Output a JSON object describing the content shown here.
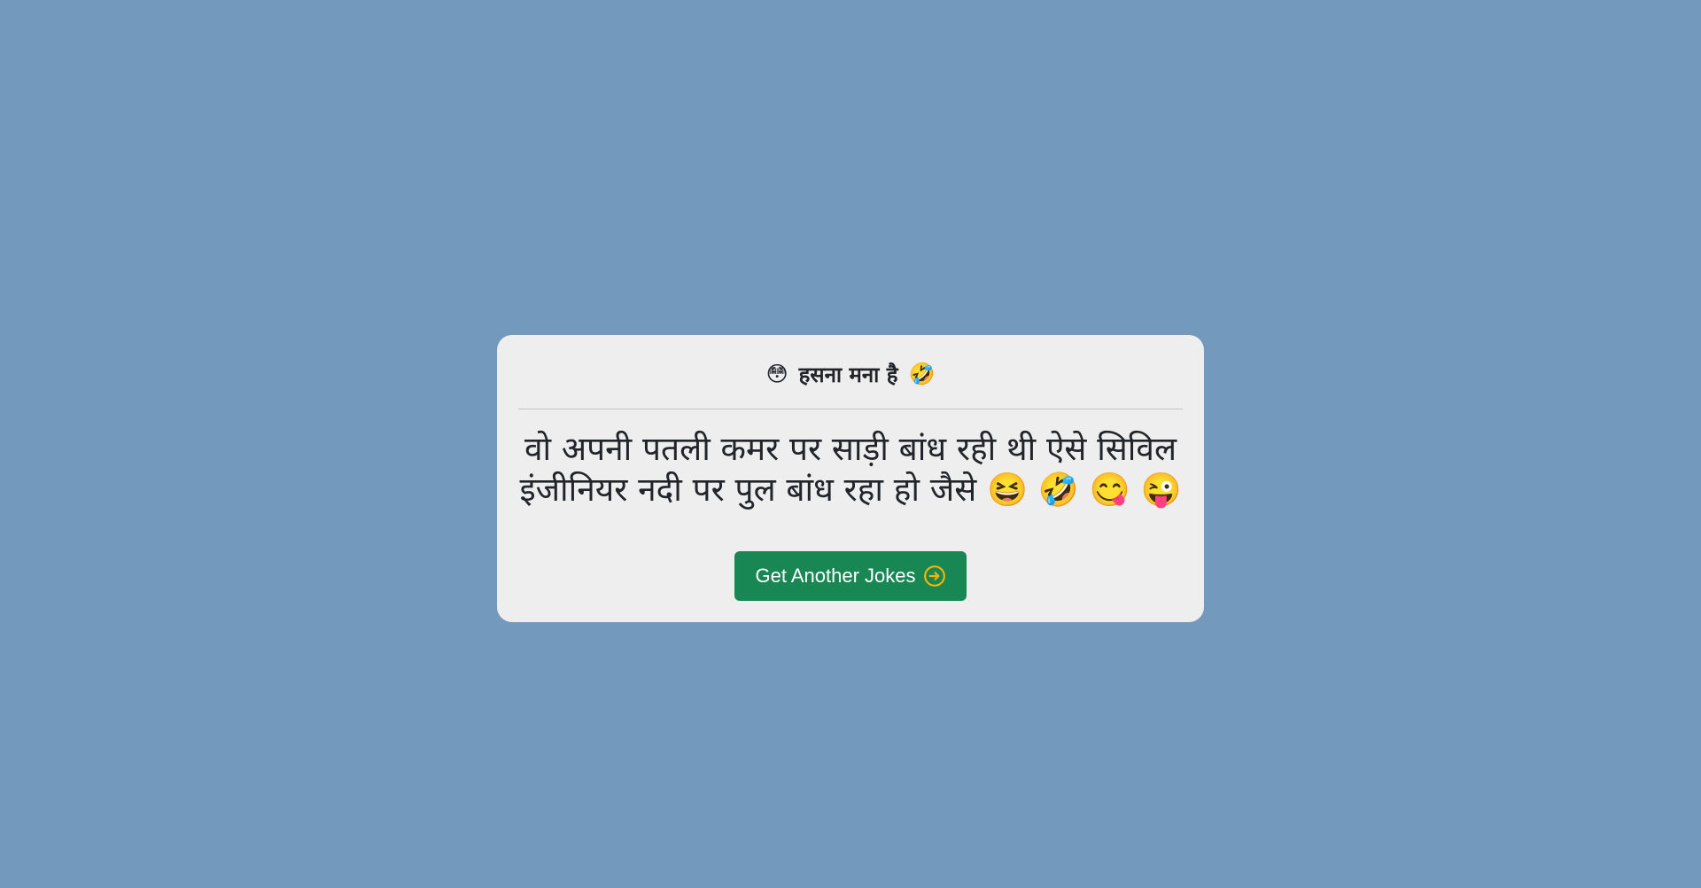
{
  "card": {
    "title": "हसना मना है",
    "title_emoji_left": "😳",
    "title_emoji_right": "🤣"
  },
  "joke": {
    "text": "वो अपनी पतली कमर पर साड़ी बांध रही थी ऐसे सिविल इंजीनियर नदी पर पुल बांध रहा हो जैसे 😆 🤣 😋 😜"
  },
  "button": {
    "label": "Get Another Jokes",
    "icon": "arrow-right-circle-icon",
    "icon_color": "#f5b400",
    "color": "#198754"
  },
  "colors": {
    "background": "#7399bd",
    "card": "#eeeeee"
  }
}
